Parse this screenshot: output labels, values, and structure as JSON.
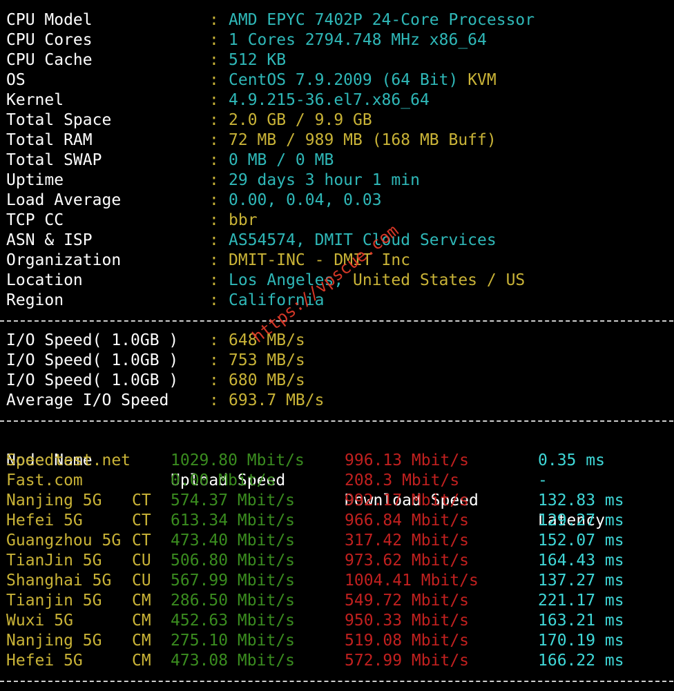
{
  "system_info": [
    {
      "label": "CPU Model",
      "parts": [
        {
          "text": "AMD EPYC 7402P 24-Core Processor",
          "color": "cyan"
        }
      ]
    },
    {
      "label": "CPU Cores",
      "parts": [
        {
          "text": "1 Cores 2794.748 MHz x86_64",
          "color": "cyan"
        }
      ]
    },
    {
      "label": "CPU Cache",
      "parts": [
        {
          "text": "512 KB",
          "color": "cyan"
        }
      ]
    },
    {
      "label": "OS",
      "parts": [
        {
          "text": "CentOS 7.9.2009 (64 Bit) ",
          "color": "cyan"
        },
        {
          "text": "KVM",
          "color": "yellow"
        }
      ]
    },
    {
      "label": "Kernel",
      "parts": [
        {
          "text": "4.9.215-36.el7.x86_64",
          "color": "cyan"
        }
      ]
    },
    {
      "label": "Total Space",
      "parts": [
        {
          "text": "2.0 GB / 9.9 GB",
          "color": "yellow"
        }
      ]
    },
    {
      "label": "Total RAM",
      "parts": [
        {
          "text": "72 MB / 989 MB (168 MB Buff)",
          "color": "yellow"
        }
      ]
    },
    {
      "label": "Total SWAP",
      "parts": [
        {
          "text": "0 MB / 0 MB",
          "color": "cyan"
        }
      ]
    },
    {
      "label": "Uptime",
      "parts": [
        {
          "text": "29 days 3 hour 1 min",
          "color": "cyan"
        }
      ]
    },
    {
      "label": "Load Average",
      "parts": [
        {
          "text": "0.00, 0.04, 0.03",
          "color": "cyan"
        }
      ]
    },
    {
      "label": "TCP CC",
      "parts": [
        {
          "text": "bbr",
          "color": "yellow"
        }
      ]
    },
    {
      "label": "ASN & ISP",
      "parts": [
        {
          "text": "AS54574, DMIT Cloud Services",
          "color": "cyan"
        }
      ]
    },
    {
      "label": "Organization",
      "parts": [
        {
          "text": "DMIT-INC - DMIT Inc",
          "color": "yellow"
        }
      ]
    },
    {
      "label": "Location",
      "parts": [
        {
          "text": "Los Angeles, ",
          "color": "cyan"
        },
        {
          "text": "United States / US",
          "color": "yellow"
        }
      ]
    },
    {
      "label": "Region",
      "parts": [
        {
          "text": "California",
          "color": "cyan"
        }
      ]
    }
  ],
  "io_speed": [
    {
      "label": "I/O Speed( 1.0GB )",
      "value": "648 MB/s"
    },
    {
      "label": "I/O Speed( 1.0GB )",
      "value": "753 MB/s"
    },
    {
      "label": "I/O Speed( 1.0GB )",
      "value": "680 MB/s"
    },
    {
      "label": "Average I/O Speed",
      "value": "693.7 MB/s"
    }
  ],
  "speedtest": {
    "headers": {
      "node": "Node Name",
      "upload": "Upload Speed",
      "download": "Download Speed",
      "latency": "Latency"
    },
    "rows": [
      {
        "node": "Speedtest.net",
        "isp": "",
        "upload": "1029.80 Mbit/s",
        "download": "996.13 Mbit/s",
        "latency": "0.35 ms"
      },
      {
        "node": "Fast.com",
        "isp": "",
        "upload": "0.00 Mbit/s",
        "download": "208.3 Mbit/s",
        "latency": "-"
      },
      {
        "node": "Nanjing 5G",
        "isp": "CT",
        "upload": "574.37 Mbit/s",
        "download": "992.17 Mbit/s",
        "latency": "132.83 ms"
      },
      {
        "node": "Hefei 5G",
        "isp": "CT",
        "upload": "613.34 Mbit/s",
        "download": "966.84 Mbit/s",
        "latency": "129.27 ms"
      },
      {
        "node": "Guangzhou 5G",
        "isp": "CT",
        "upload": "473.40 Mbit/s",
        "download": "317.42 Mbit/s",
        "latency": "152.07 ms"
      },
      {
        "node": "TianJin 5G",
        "isp": "CU",
        "upload": "506.80 Mbit/s",
        "download": "973.62 Mbit/s",
        "latency": "164.43 ms"
      },
      {
        "node": "Shanghai 5G",
        "isp": "CU",
        "upload": "567.99 Mbit/s",
        "download": "1004.41 Mbit/s",
        "latency": "137.27 ms"
      },
      {
        "node": "Tianjin 5G",
        "isp": "CM",
        "upload": "286.50 Mbit/s",
        "download": "549.72 Mbit/s",
        "latency": "221.17 ms"
      },
      {
        "node": "Wuxi 5G",
        "isp": "CM",
        "upload": "452.63 Mbit/s",
        "download": "950.33 Mbit/s",
        "latency": "163.21 ms"
      },
      {
        "node": "Nanjing 5G",
        "isp": "CM",
        "upload": "275.10 Mbit/s",
        "download": "519.08 Mbit/s",
        "latency": "170.19 ms"
      },
      {
        "node": "Hefei 5G",
        "isp": "CM",
        "upload": "473.08 Mbit/s",
        "download": "572.99 Mbit/s",
        "latency": "166.22 ms"
      }
    ]
  },
  "watermark": "https://vpscue.com",
  "colors": {
    "background": "#000000",
    "label": "#ffffff",
    "cyan": "#2fb8b8",
    "yellow": "#c9b337",
    "green": "#3a8c1f",
    "red": "#c1201f",
    "latency": "#3fd7d7",
    "watermark": "#e03a2a"
  }
}
